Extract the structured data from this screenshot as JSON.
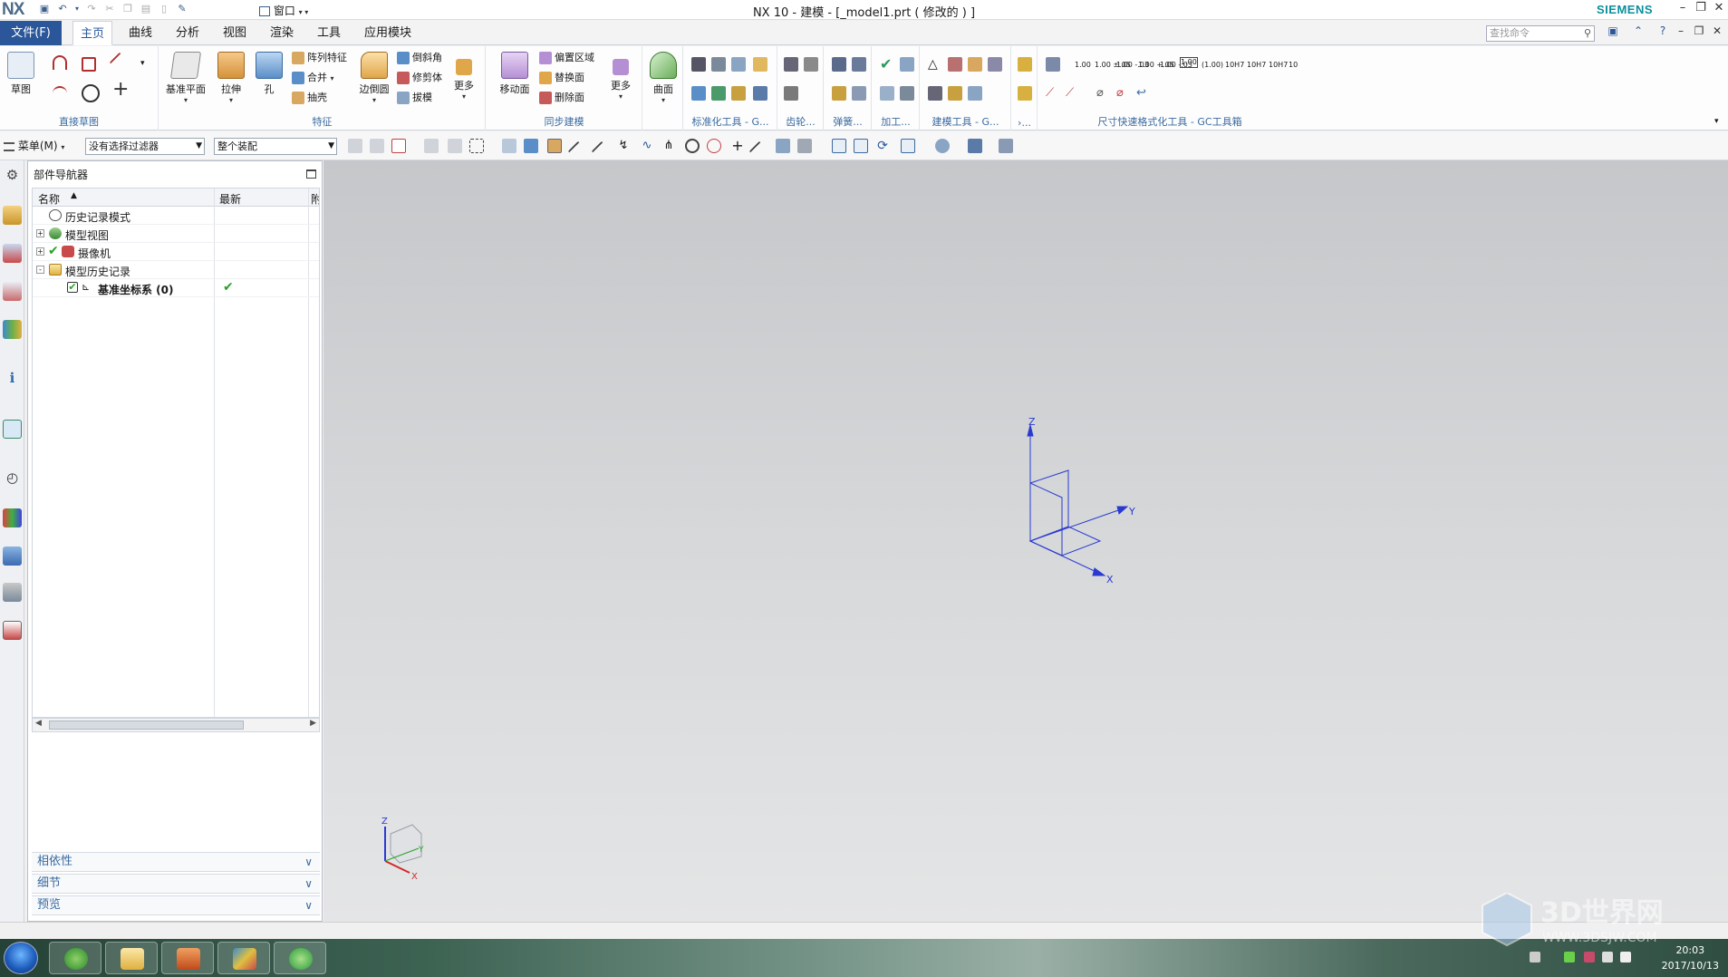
{
  "app": {
    "logo": "NX",
    "window_title": "NX 10 - 建模 - [_model1.prt  ( 修改的 ) ]",
    "brand": "SIEMENS",
    "window_menu": "窗口"
  },
  "tabs": {
    "file": "文件(F)",
    "items": [
      "主页",
      "曲线",
      "分析",
      "视图",
      "渲染",
      "工具",
      "应用模块"
    ],
    "active": "主页",
    "search_placeholder": "查找命令"
  },
  "ribbon": {
    "direct_sketch": {
      "label": "直接草图",
      "sketch": "草图"
    },
    "feature": {
      "label": "特征",
      "datum_plane": "基准平面",
      "extrude": "拉伸",
      "hole": "孔",
      "pattern_feature": "阵列特征",
      "unite": "合并",
      "shell": "抽壳",
      "edge_blend": "边倒圆",
      "chamfer": "倒斜角",
      "trim_body": "修剪体",
      "draft": "拔模",
      "more": "更多"
    },
    "sync_modeling": {
      "label": "同步建模",
      "move_face": "移动面",
      "offset_region": "偏置区域",
      "replace_face": "替换面",
      "delete_face": "删除面",
      "more": "更多"
    },
    "surface": {
      "label": "曲面"
    },
    "groups_tail": [
      "标准化工具 - G...",
      "齿轮...",
      "弹簧...",
      "加工...",
      "建模工具 - G...",
      "›...",
      "尺寸快速格式化工具 - GC工具箱"
    ],
    "dim_labels": [
      "1.00",
      "1.00\n±.05",
      "1.00\n-.03",
      "1.00\n+.05",
      "1.00\n-.03",
      "1.00",
      "(1.00)",
      "10H7",
      "10H7",
      "10H7",
      "10"
    ]
  },
  "selection_bar": {
    "menu": "菜单(M)",
    "filter": "没有选择过滤器",
    "scope": "整个装配"
  },
  "navigator": {
    "title": "部件导航器",
    "columns": [
      "名称",
      "最新",
      "附"
    ],
    "rows": [
      {
        "name": "历史记录模式",
        "indent": 0,
        "expander": "",
        "latest": ""
      },
      {
        "name": "模型视图",
        "indent": 0,
        "expander": "+",
        "latest": ""
      },
      {
        "name": "摄像机",
        "indent": 0,
        "expander": "+",
        "latest": ""
      },
      {
        "name": "模型历史记录",
        "indent": 0,
        "expander": "-",
        "latest": ""
      },
      {
        "name": "基准坐标系 (0)",
        "indent": 1,
        "expander": "",
        "latest": "✔"
      }
    ],
    "panels": [
      "相依性",
      "细节",
      "预览"
    ]
  },
  "graphics": {
    "axis_labels": {
      "x": "X",
      "y": "Y",
      "z": "Z"
    }
  },
  "taskbar": {
    "time": "20:03",
    "date": "2017/10/13",
    "watermark_text": "3D世界网",
    "watermark_url": "WWW.3DSJW.COM"
  }
}
